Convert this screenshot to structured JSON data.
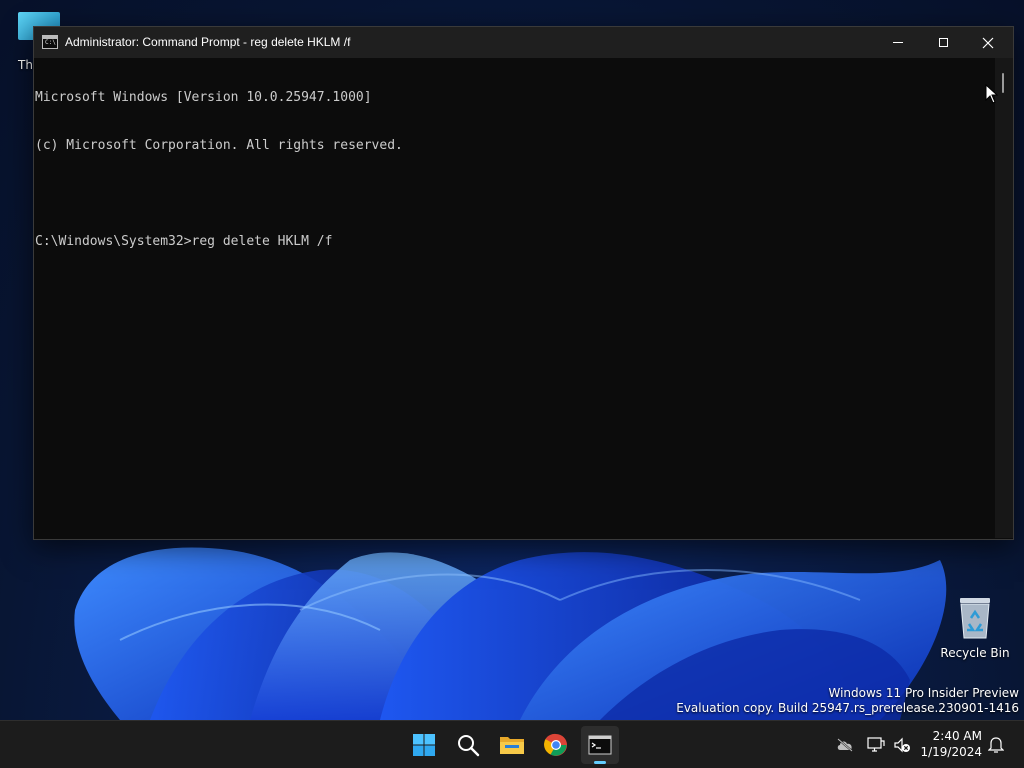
{
  "desktop": {
    "this_pc_label_partial": "Th",
    "recycle_bin_label": "Recycle Bin",
    "watermark": {
      "line1": "Windows 11 Pro Insider Preview",
      "line2": "Evaluation copy. Build 25947.rs_prerelease.230901-1416"
    }
  },
  "window": {
    "title": "Administrator: Command Prompt - reg  delete HKLM /f",
    "icon": "cmd-icon",
    "console_lines": [
      "Microsoft Windows [Version 10.0.25947.1000]",
      "(c) Microsoft Corporation. All rights reserved.",
      "",
      "C:\\Windows\\System32>reg delete HKLM /f"
    ]
  },
  "taskbar": {
    "apps": [
      "windows-start-icon",
      "search-icon",
      "file-explorer-icon",
      "chrome-icon",
      "command-prompt-icon"
    ],
    "active_app": "command-prompt-icon",
    "accent_color": "#62cdfe",
    "tray": {
      "time": "2:40 AM",
      "date": "1/19/2024"
    }
  }
}
